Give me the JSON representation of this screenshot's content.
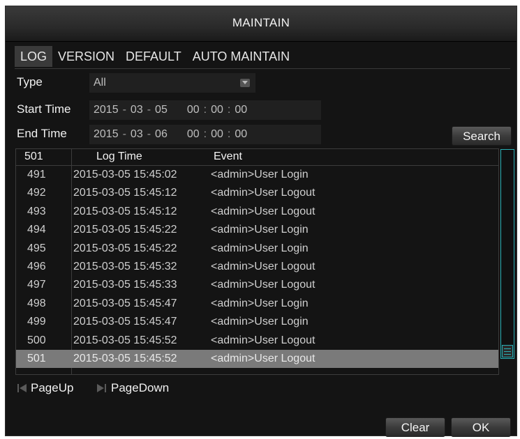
{
  "window": {
    "title": "MAINTAIN"
  },
  "tabs": [
    {
      "label": "LOG",
      "active": true
    },
    {
      "label": "VERSION",
      "active": false
    },
    {
      "label": "DEFAULT",
      "active": false
    },
    {
      "label": "AUTO MAINTAIN",
      "active": false
    }
  ],
  "filters": {
    "type_label": "Type",
    "type_value": "All",
    "start_label": "Start Time",
    "start": {
      "year": "2015",
      "month": "03",
      "day": "05",
      "hour": "00",
      "minute": "00",
      "second": "00"
    },
    "end_label": "End Time",
    "end": {
      "year": "2015",
      "month": "03",
      "day": "06",
      "hour": "00",
      "minute": "00",
      "second": "00"
    },
    "date_sep": "-",
    "time_sep": ":",
    "search_label": "Search"
  },
  "log": {
    "columns": [
      "501",
      "Log Time",
      "Event"
    ],
    "rows": [
      {
        "no": "491",
        "time": "2015-03-05 15:45:02",
        "event": "<admin>User Login"
      },
      {
        "no": "492",
        "time": "2015-03-05 15:45:12",
        "event": "<admin>User Logout"
      },
      {
        "no": "493",
        "time": "2015-03-05 15:45:12",
        "event": "<admin>User Logout"
      },
      {
        "no": "494",
        "time": "2015-03-05 15:45:22",
        "event": "<admin>User Login"
      },
      {
        "no": "495",
        "time": "2015-03-05 15:45:22",
        "event": "<admin>User Login"
      },
      {
        "no": "496",
        "time": "2015-03-05 15:45:32",
        "event": "<admin>User Logout"
      },
      {
        "no": "497",
        "time": "2015-03-05 15:45:33",
        "event": "<admin>User Logout"
      },
      {
        "no": "498",
        "time": "2015-03-05 15:45:47",
        "event": "<admin>User Login"
      },
      {
        "no": "499",
        "time": "2015-03-05 15:45:47",
        "event": "<admin>User Login"
      },
      {
        "no": "500",
        "time": "2015-03-05 15:45:52",
        "event": "<admin>User Logout"
      },
      {
        "no": "501",
        "time": "2015-03-05 15:45:52",
        "event": "<admin>User Logout"
      }
    ],
    "selected_row": "501"
  },
  "pager": {
    "page_up": "PageUp",
    "page_down": "PageDown"
  },
  "footer": {
    "clear_label": "Clear",
    "ok_label": "OK"
  },
  "colors": {
    "accent": "#2ab0b5",
    "background": "#141414",
    "selected_row": "#7a7a7a"
  }
}
